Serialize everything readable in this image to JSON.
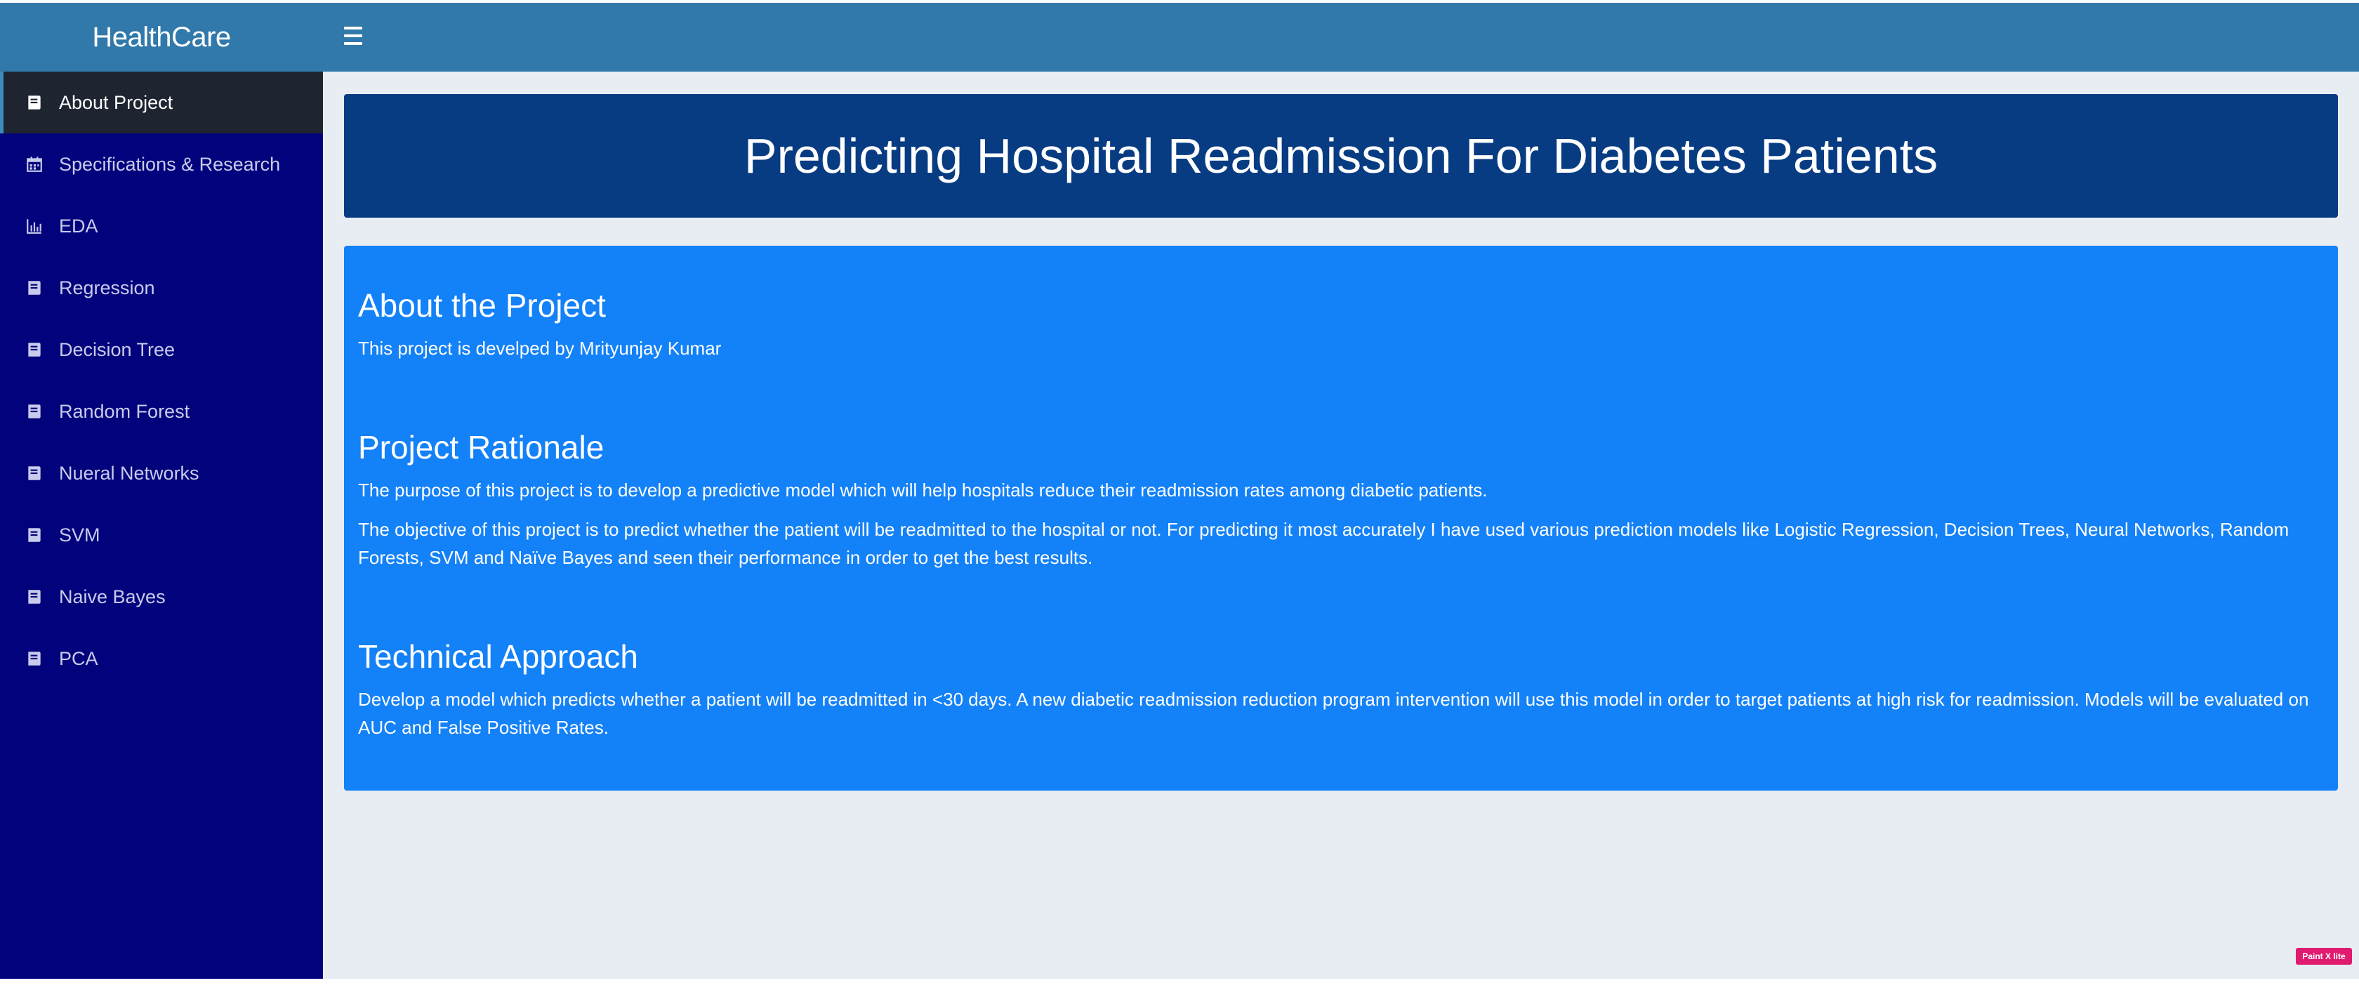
{
  "app": {
    "brand": "HealthCare"
  },
  "sidebar": {
    "items": [
      {
        "label": "About Project",
        "icon": "book-icon",
        "active": true
      },
      {
        "label": "Specifications & Research",
        "icon": "calendar-icon",
        "active": false
      },
      {
        "label": "EDA",
        "icon": "bar-chart-icon",
        "active": false
      },
      {
        "label": "Regression",
        "icon": "book-icon",
        "active": false
      },
      {
        "label": "Decision Tree",
        "icon": "book-icon",
        "active": false
      },
      {
        "label": "Random Forest",
        "icon": "book-icon",
        "active": false
      },
      {
        "label": "Nueral Networks",
        "icon": "book-icon",
        "active": false
      },
      {
        "label": "SVM",
        "icon": "book-icon",
        "active": false
      },
      {
        "label": "Naive Bayes",
        "icon": "book-icon",
        "active": false
      },
      {
        "label": "PCA",
        "icon": "book-icon",
        "active": false
      }
    ]
  },
  "header": {
    "menu_icon": "hamburger-icon"
  },
  "main": {
    "title": "Predicting Hospital Readmission For Diabetes Patients",
    "sections": [
      {
        "heading": "About the Project",
        "paragraphs": [
          "This project is develped by Mrityunjay Kumar"
        ]
      },
      {
        "heading": "Project Rationale",
        "paragraphs": [
          "The purpose of this project is to develop a predictive model which will help hospitals reduce their readmission rates among diabetic patients.",
          "The objective of this project is to predict whether the patient will be readmitted to the hospital or not. For predicting it most accurately I have used various prediction models like Logistic Regression, Decision Trees, Neural Networks, Random Forests, SVM and Naïve Bayes and seen their performance in order to get the best results."
        ]
      },
      {
        "heading": "Technical Approach",
        "paragraphs": [
          "Develop a model which predicts whether a patient will be readmitted in <30 days. A new diabetic readmission reduction program intervention will use this model in order to target patients at high risk for readmission. Models will be evaluated on AUC and False Positive Rates."
        ]
      }
    ]
  },
  "badge": {
    "label": "Paint X lite"
  },
  "colors": {
    "sidebar_bg": "#02037c",
    "header_bg": "#3279ab",
    "title_bg": "#073c82",
    "info_bg": "#1381f7",
    "active_item_bg": "#1e2430",
    "page_bg": "#e8ecf3"
  }
}
